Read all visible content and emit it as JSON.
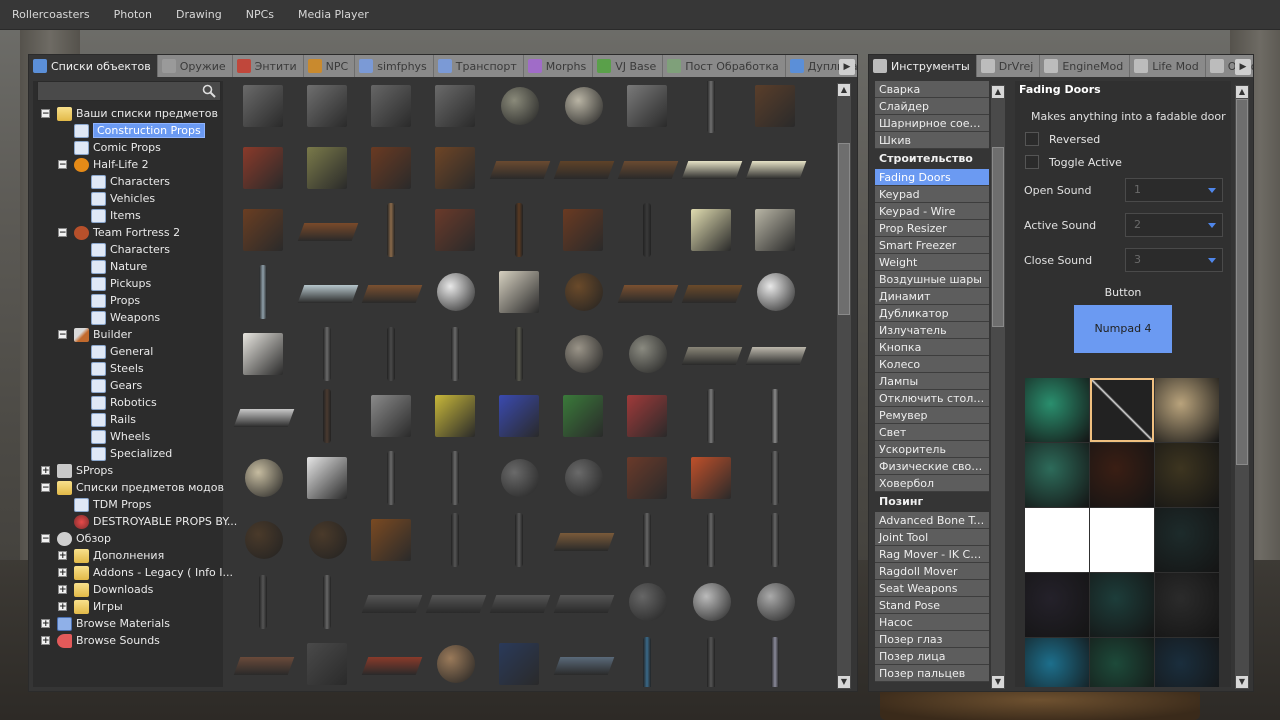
{
  "menubar": [
    "Rollercoasters",
    "Photon",
    "Drawing",
    "NPCs",
    "Media Player"
  ],
  "spawnmenu": {
    "tabs": [
      {
        "label": "Списки объектов",
        "icon": "list-icon",
        "active": true
      },
      {
        "label": "Оружие",
        "icon": "gun-icon"
      },
      {
        "label": "Энтити",
        "icon": "entity-icon"
      },
      {
        "label": "NPC",
        "icon": "monkey-icon"
      },
      {
        "label": "simfphys",
        "icon": "car-icon"
      },
      {
        "label": "Транспорт",
        "icon": "car-icon"
      },
      {
        "label": "Morphs",
        "icon": "morph-icon"
      },
      {
        "label": "VJ Base",
        "icon": "puzzle-icon"
      },
      {
        "label": "Пост Обработка",
        "icon": "image-icon"
      },
      {
        "label": "Дупликации",
        "icon": "duplicate-icon"
      }
    ],
    "tree": [
      {
        "label": "Ваши списки предметов",
        "icon": "folder",
        "depth": 0,
        "exp": "−"
      },
      {
        "label": "Construction Props",
        "icon": "page",
        "depth": 1,
        "selected": true
      },
      {
        "label": "Comic Props",
        "icon": "page",
        "depth": 1
      },
      {
        "label": "Half-Life 2",
        "icon": "hl",
        "depth": 1,
        "exp": "−"
      },
      {
        "label": "Characters",
        "icon": "page",
        "depth": 2
      },
      {
        "label": "Vehicles",
        "icon": "page",
        "depth": 2
      },
      {
        "label": "Items",
        "icon": "page",
        "depth": 2
      },
      {
        "label": "Team Fortress 2",
        "icon": "tf",
        "depth": 1,
        "exp": "−"
      },
      {
        "label": "Characters",
        "icon": "page",
        "depth": 2
      },
      {
        "label": "Nature",
        "icon": "page",
        "depth": 2
      },
      {
        "label": "Pickups",
        "icon": "page",
        "depth": 2
      },
      {
        "label": "Props",
        "icon": "page",
        "depth": 2
      },
      {
        "label": "Weapons",
        "icon": "page",
        "depth": 2
      },
      {
        "label": "Builder",
        "icon": "tool",
        "depth": 1,
        "exp": "−"
      },
      {
        "label": "General",
        "icon": "page",
        "depth": 2
      },
      {
        "label": "Steels",
        "icon": "page",
        "depth": 2
      },
      {
        "label": "Gears",
        "icon": "page",
        "depth": 2
      },
      {
        "label": "Robotics",
        "icon": "page",
        "depth": 2
      },
      {
        "label": "Rails",
        "icon": "page",
        "depth": 2
      },
      {
        "label": "Wheels",
        "icon": "page",
        "depth": 2
      },
      {
        "label": "Specialized",
        "icon": "page",
        "depth": 2
      },
      {
        "label": "SProps",
        "icon": "box",
        "depth": 0,
        "exp": "+"
      },
      {
        "label": "Списки предметов модов",
        "icon": "folder",
        "depth": 0,
        "exp": "−"
      },
      {
        "label": "TDM Props",
        "icon": "page",
        "depth": 1
      },
      {
        "label": "DESTROYABLE PROPS BY...",
        "icon": "des",
        "depth": 1
      },
      {
        "label": "Обзор",
        "icon": "gear",
        "depth": 0,
        "exp": "−"
      },
      {
        "label": "Дополнения",
        "icon": "folder",
        "depth": 1,
        "exp": "+"
      },
      {
        "label": "Addons - Legacy ( Info I...",
        "icon": "folder",
        "depth": 1,
        "exp": "+"
      },
      {
        "label": "Downloads",
        "icon": "folder",
        "depth": 1,
        "exp": "+"
      },
      {
        "label": "Игры",
        "icon": "folder",
        "depth": 1,
        "exp": "+"
      },
      {
        "label": "Browse Materials",
        "icon": "blue",
        "depth": 0,
        "exp": "+"
      },
      {
        "label": "Browse Sounds",
        "icon": "snd",
        "depth": 0,
        "exp": "+"
      }
    ]
  },
  "toolmenu": {
    "tabs": [
      {
        "label": "Инструменты",
        "icon": "wrench-icon",
        "active": true
      },
      {
        "label": "DrVrej",
        "icon": "wrench-icon"
      },
      {
        "label": "EngineMod",
        "icon": "wrench-icon"
      },
      {
        "label": "Life Mod",
        "icon": "wrench-icon"
      },
      {
        "label": "Optio",
        "icon": "wrench-icon"
      }
    ],
    "list": [
      {
        "type": "item",
        "label": "Сварка"
      },
      {
        "type": "item",
        "label": "Слайдер"
      },
      {
        "type": "item",
        "label": "Шарнирное соеди..."
      },
      {
        "type": "item",
        "label": "Шкив"
      },
      {
        "type": "cat",
        "label": "Строительство"
      },
      {
        "type": "item",
        "label": "Fading Doors",
        "selected": true
      },
      {
        "type": "item",
        "label": "Keypad"
      },
      {
        "type": "item",
        "label": "Keypad - Wire"
      },
      {
        "type": "item",
        "label": "Prop Resizer"
      },
      {
        "type": "item",
        "label": "Smart Freezer"
      },
      {
        "type": "item",
        "label": "Weight"
      },
      {
        "type": "item",
        "label": "Воздушные шары"
      },
      {
        "type": "item",
        "label": "Динамит"
      },
      {
        "type": "item",
        "label": "Дубликатор"
      },
      {
        "type": "item",
        "label": "Излучатель"
      },
      {
        "type": "item",
        "label": "Кнопка"
      },
      {
        "type": "item",
        "label": "Колесо"
      },
      {
        "type": "item",
        "label": "Лампы"
      },
      {
        "type": "item",
        "label": "Отключить столк..."
      },
      {
        "type": "item",
        "label": "Ремувер"
      },
      {
        "type": "item",
        "label": "Свет"
      },
      {
        "type": "item",
        "label": "Ускоритель"
      },
      {
        "type": "item",
        "label": "Физические свойс..."
      },
      {
        "type": "item",
        "label": "Ховербол"
      },
      {
        "type": "cat",
        "label": "Позинг"
      },
      {
        "type": "item",
        "label": "Advanced Bone Tool"
      },
      {
        "type": "item",
        "label": "Joint Tool"
      },
      {
        "type": "item",
        "label": "Rag Mover - IK Ch..."
      },
      {
        "type": "item",
        "label": "Ragdoll Mover"
      },
      {
        "type": "item",
        "label": "Seat Weapons"
      },
      {
        "type": "item",
        "label": "Stand Pose"
      },
      {
        "type": "item",
        "label": "Насос"
      },
      {
        "type": "item",
        "label": "Позер глаз"
      },
      {
        "type": "item",
        "label": "Позер лица"
      },
      {
        "type": "item",
        "label": "Позер пальцев"
      }
    ],
    "settings": {
      "title": "Fading Doors",
      "description": "Makes anything into a fadable door",
      "reversed_label": "Reversed",
      "toggle_label": "Toggle Active",
      "open_sound_label": "Open Sound",
      "open_sound_value": "1",
      "active_sound_label": "Active Sound",
      "active_sound_value": "2",
      "close_sound_label": "Close Sound",
      "close_sound_value": "3",
      "button_label": "Button",
      "button_value": "Numpad 4",
      "materials": [
        "#2a8f6e",
        "#1c1c1c",
        "#b9a37c",
        "#2d6b5a",
        "#3a1e14",
        "#3d3520",
        "#ffffff",
        "#ffffff",
        "#1d2b2b",
        "#24212a",
        "#1d3d3a",
        "#2b2b2b",
        "#1d6f8c",
        "#1d4a3a",
        "#1a2e3d"
      ]
    }
  },
  "colors": {
    "accent": "#6b9af2",
    "panel": "#353535"
  }
}
